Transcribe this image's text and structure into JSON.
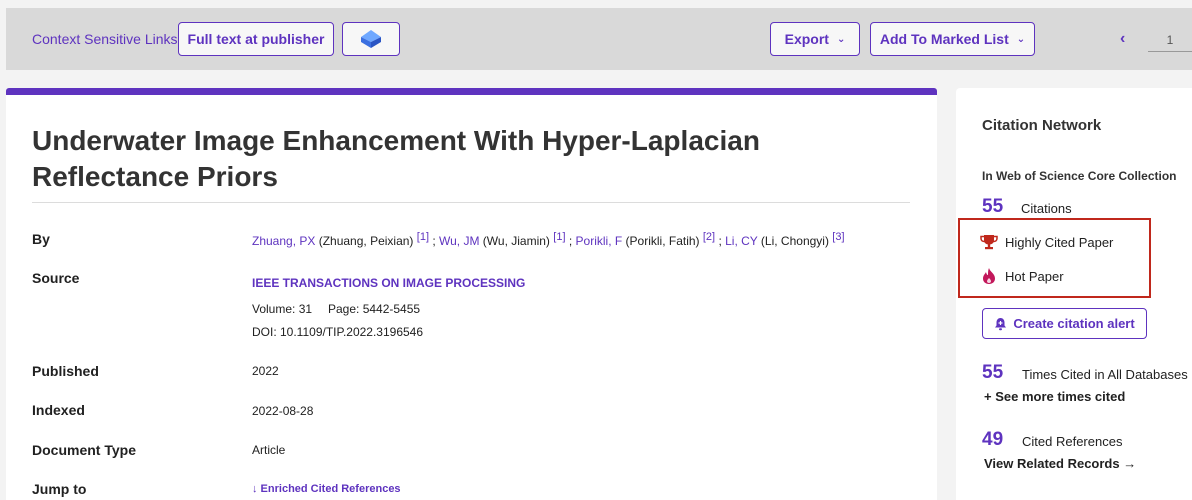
{
  "toolbar": {
    "context_links": "Context Sensitive Links",
    "full_text": "Full text at publisher",
    "export": "Export",
    "add_marked": "Add To Marked List",
    "prev": "‹",
    "page": "1"
  },
  "record": {
    "title": "Underwater Image Enhancement With Hyper-Laplacian Reflectance Priors",
    "by_label": "By",
    "authors": [
      {
        "short": "Zhuang, PX",
        "full": " (Zhuang, Peixian) ",
        "ref": "[1]",
        "sep": " ; "
      },
      {
        "short": "Wu, JM",
        "full": " (Wu, Jiamin) ",
        "ref": "[1]",
        "sep": " ; "
      },
      {
        "short": "Porikli, F",
        "full": " (Porikli, Fatih) ",
        "ref": "[2]",
        "sep": " ; "
      },
      {
        "short": "Li, CY",
        "full": " (Li, Chongyi) ",
        "ref": "[3]",
        "sep": ""
      }
    ],
    "source_label": "Source",
    "source_title": "IEEE TRANSACTIONS ON IMAGE PROCESSING",
    "volume": "Volume: 31",
    "page": "Page: 5442-5455",
    "doi": "DOI: 10.1109/TIP.2022.3196546",
    "published_label": "Published",
    "published": "2022",
    "indexed_label": "Indexed",
    "indexed": "2022-08-28",
    "doctype_label": "Document Type",
    "doctype": "Article",
    "jump_label": "Jump to",
    "jump_link": "↓ Enriched Cited References"
  },
  "citation": {
    "heading": "Citation Network",
    "collection": "In Web of Science Core Collection",
    "citations_count": "55",
    "citations_label": "Citations",
    "highly_cited": "Highly Cited Paper",
    "hot_paper": "Hot Paper",
    "alert": "Create citation alert",
    "all_db_count": "55",
    "all_db_label": "Times Cited in All Databases",
    "see_more": "+ See more times cited",
    "refs_count": "49",
    "refs_label": "Cited References",
    "related": "View Related Records →"
  },
  "colors": {
    "accent": "#5e33bf",
    "highlight_border": "#c0281c",
    "trophy": "#c0281c",
    "flame": "#c2185b"
  }
}
